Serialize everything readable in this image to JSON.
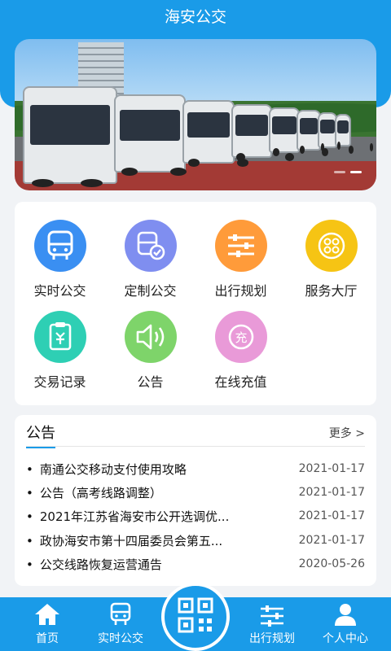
{
  "header": {
    "title": "海安公交"
  },
  "banner": {
    "slide_count": 2,
    "active_slide": 1
  },
  "menu": [
    {
      "label": "实时公交",
      "icon": "bus-icon",
      "color": "#3a8ff2"
    },
    {
      "label": "定制公交",
      "icon": "custom-bus-icon",
      "color": "#7f8ef0"
    },
    {
      "label": "出行规划",
      "icon": "route-plan-icon",
      "color": "#ff9b3a"
    },
    {
      "label": "服务大厅",
      "icon": "service-hall-icon",
      "color": "#f6c414"
    },
    {
      "label": "交易记录",
      "icon": "transaction-record-icon",
      "color": "#2ecfb4"
    },
    {
      "label": "公告",
      "icon": "speaker-icon",
      "color": "#7ed46a"
    },
    {
      "label": "在线充值",
      "icon": "recharge-icon",
      "color": "#e99ad8"
    }
  ],
  "notice": {
    "title": "公告",
    "more": "更多 >",
    "items": [
      {
        "text": "南通公交移动支付使用攻略",
        "date": "2021-01-17"
      },
      {
        "text": "公告（高考线路调整）",
        "date": "2021-01-17"
      },
      {
        "text": "2021年江苏省海安市公开选调优...",
        "date": "2021-01-17"
      },
      {
        "text": "政协海安市第十四届委员会第五...",
        "date": "2021-01-17"
      },
      {
        "text": "公交线路恢复运营通告",
        "date": "2020-05-26"
      }
    ]
  },
  "tabbar": {
    "home": "首页",
    "realtime": "实时公交",
    "plan": "出行规划",
    "profile": "个人中心",
    "scan_icon": "qr-code-icon"
  },
  "colors": {
    "primary": "#1a9be8"
  }
}
